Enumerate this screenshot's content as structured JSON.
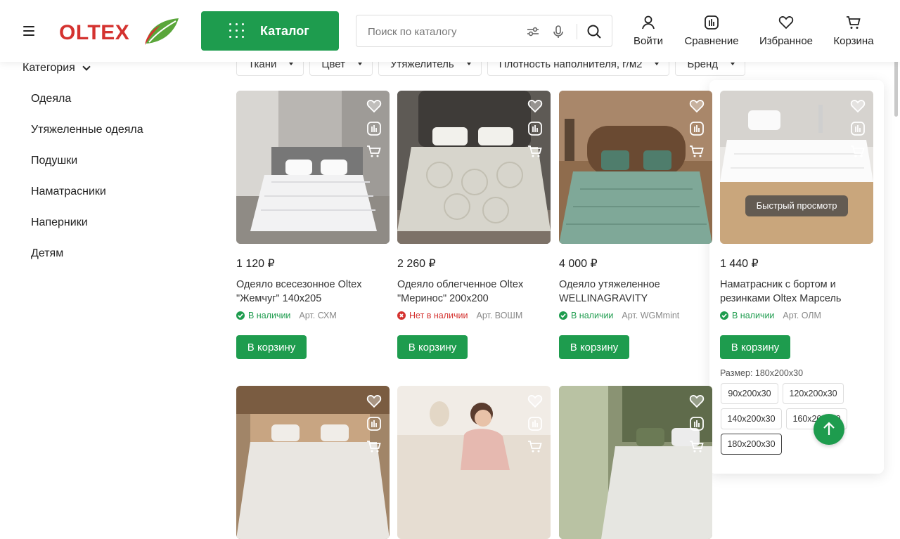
{
  "header": {
    "logo_text": "OLTEX",
    "catalog_label": "Каталог",
    "search_placeholder": "Поиск по каталогу",
    "links": [
      {
        "label": "Войти",
        "icon": "user-icon"
      },
      {
        "label": "Сравнение",
        "icon": "compare-icon"
      },
      {
        "label": "Избранное",
        "icon": "heart-icon"
      },
      {
        "label": "Корзина",
        "icon": "cart-icon"
      }
    ]
  },
  "filters": [
    "Ткани",
    "Цвет",
    "Утяжелитель",
    "Плотность наполнителя, г/м2",
    "Бренд"
  ],
  "sidebar": {
    "title": "Категория",
    "items": [
      "Одеяла",
      "Утяжеленные одеяла",
      "Подушки",
      "Наматрасники",
      "Наперники",
      "Детям"
    ]
  },
  "products": [
    {
      "price": "1 120 ₽",
      "name": "Одеяло всесезонное Oltex \"Жемчуг\" 140x205",
      "stock": "В наличии",
      "in_stock": true,
      "article": "Арт. СХМ",
      "buy": "В корзину"
    },
    {
      "price": "2 260 ₽",
      "name": "Одеяло облегченное Oltex \"Меринос\" 200x200",
      "stock": "Нет в наличии",
      "in_stock": false,
      "article": "Арт. ВОШМ",
      "buy": "В корзину"
    },
    {
      "price": "4 000 ₽",
      "name": "Одеяло утяжеленное WELLINAGRAVITY",
      "stock": "В наличии",
      "in_stock": true,
      "article": "Арт. WGMmint",
      "buy": "В корзину"
    },
    {
      "price": "1 440 ₽",
      "name": "Наматрасник с бортом и резинками Oltex Марсель",
      "stock": "В наличии",
      "in_stock": true,
      "article": "Арт. ОЛМ",
      "buy": "В корзину"
    }
  ],
  "quick_view": "Быстрый просмотр",
  "sizes": {
    "label": "Размер: 180x200x30",
    "options": [
      "90x200x30",
      "120x200x30",
      "140x200x30",
      "160x200x30",
      "180x200x30"
    ],
    "selected": "180x200x30"
  },
  "colors": {
    "brand_green": "#1e9c4e",
    "brand_red": "#d4322f"
  }
}
